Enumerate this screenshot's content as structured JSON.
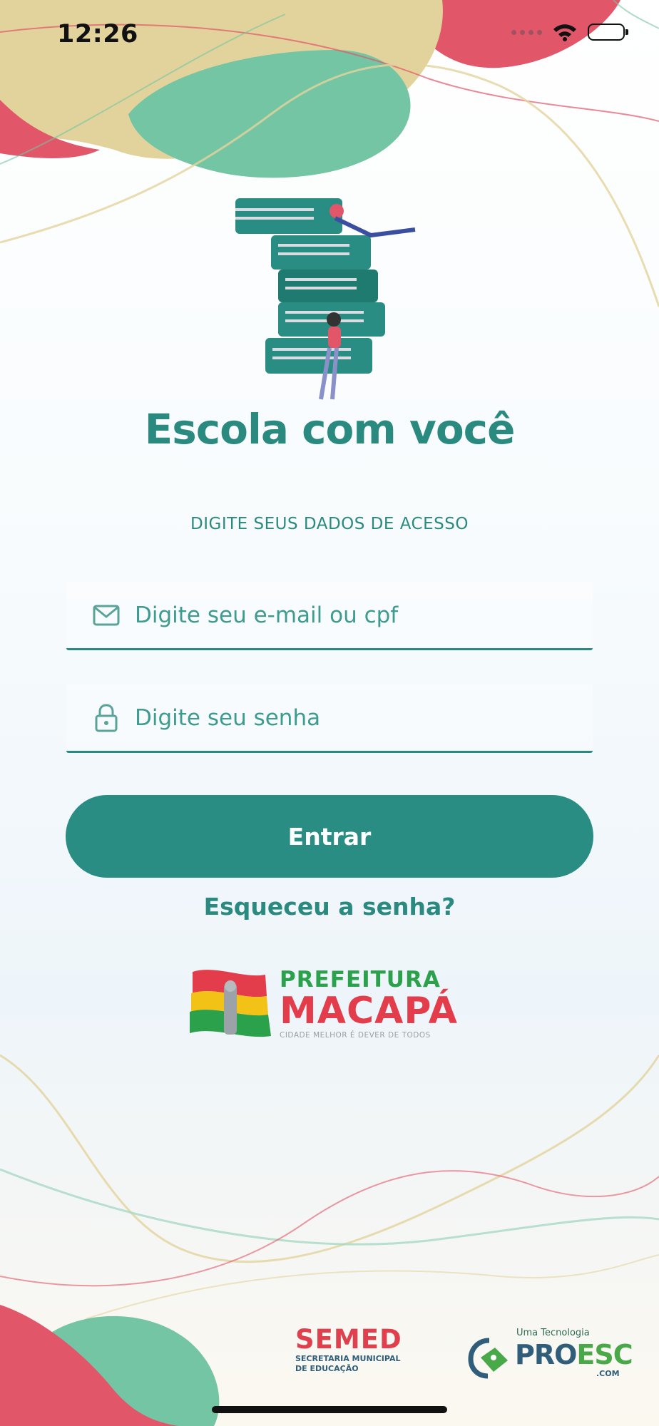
{
  "status_bar": {
    "time": "12:26",
    "icons": [
      "cellular-signal-icon",
      "wifi-icon",
      "battery-icon"
    ]
  },
  "logo": {
    "title": "Escola com você",
    "art": "books-stack-with-readers-illustration"
  },
  "form": {
    "access_label": "DIGITE SEUS DADOS DE ACESSO",
    "email_placeholder": "Digite seu e-mail ou cpf",
    "email_value": "",
    "email_icon": "mail-icon",
    "password_placeholder": "Digite seu senha",
    "password_value": "",
    "password_icon": "lock-icon",
    "submit_label": "Entrar",
    "forgot_label": "Esqueceu a senha?"
  },
  "prefeitura": {
    "line1": "PREFEITURA",
    "line2": "MACAPÁ",
    "tagline": "CIDADE MELHOR É DEVER DE TODOS"
  },
  "footer": {
    "semed_title": "SEMED",
    "semed_sub_1": "SECRETARIA MUNICIPAL",
    "semed_sub_2": "DE EDUCAÇÃO",
    "proesc_small": "Uma Tecnologia",
    "proesc_pro": "PRO",
    "proesc_esc": "ESC",
    "proesc_com": ".COM"
  },
  "colors": {
    "primary": "#2a8d83",
    "accent_red": "#e0505f",
    "accent_green": "#6cc3a0",
    "accent_sand": "#e0d29a"
  }
}
